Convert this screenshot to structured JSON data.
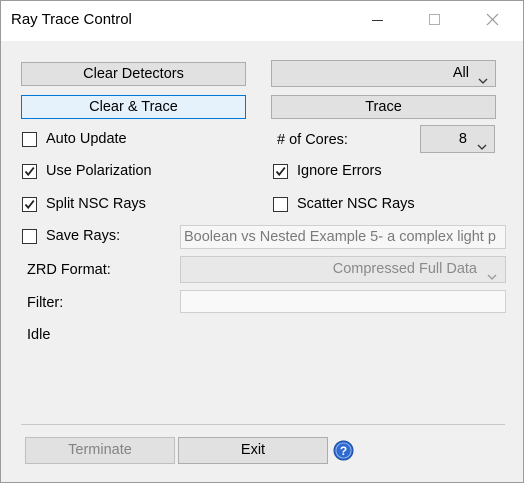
{
  "window": {
    "title": "Ray Trace Control"
  },
  "buttons": {
    "clear_detectors": "Clear Detectors",
    "clear_trace": "Clear & Trace",
    "trace": "Trace",
    "terminate": "Terminate",
    "exit": "Exit"
  },
  "dropdowns": {
    "source": {
      "selected": "All"
    },
    "cores": {
      "selected": "8"
    },
    "zrd_format": {
      "selected": "Compressed Full Data"
    }
  },
  "checkboxes": {
    "auto_update": {
      "label": "Auto Update",
      "checked": false
    },
    "use_polarization": {
      "label": "Use Polarization",
      "checked": true
    },
    "ignore_errors": {
      "label": "Ignore Errors",
      "checked": true
    },
    "split_nsc_rays": {
      "label": "Split NSC Rays",
      "checked": true
    },
    "scatter_nsc_rays": {
      "label": "Scatter NSC Rays",
      "checked": false
    },
    "save_rays": {
      "label": "Save Rays:",
      "checked": false
    }
  },
  "labels": {
    "cores": "# of Cores:",
    "zrd_format": "ZRD Format:",
    "filter": "Filter:"
  },
  "fields": {
    "save_rays_file": "Boolean vs Nested Example 5-  a complex light p",
    "filter": ""
  },
  "status": "Idle",
  "icons": {
    "minimize": "minimize-icon",
    "maximize": "maximize-icon",
    "close": "close-icon",
    "help": "help-icon",
    "dropdown": "chevron-down-icon",
    "check": "checkmark-icon"
  },
  "colors": {
    "focus_border": "#0078d7",
    "help_blue": "#2f6bd1"
  }
}
